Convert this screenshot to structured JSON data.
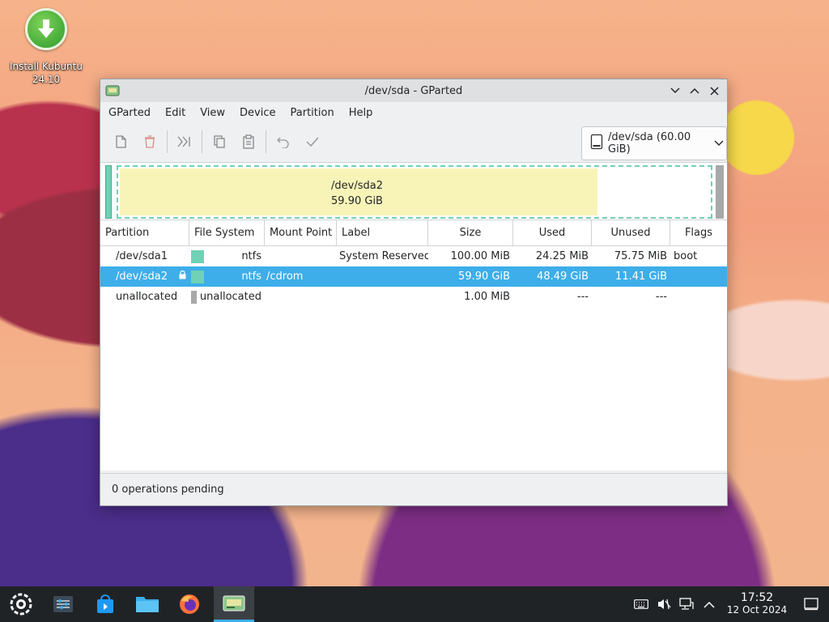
{
  "desktop": {
    "icon_label_line1": "Install Kubuntu",
    "icon_label_line2": "24.10"
  },
  "window": {
    "title": "/dev/sda - GParted"
  },
  "menubar": {
    "items": [
      "GParted",
      "Edit",
      "View",
      "Device",
      "Partition",
      "Help"
    ]
  },
  "toolbar": {
    "device_select": "/dev/sda (60.00 GiB)"
  },
  "partition_map": {
    "selected_name": "/dev/sda2",
    "selected_size": "59.90 GiB",
    "sda2_used_fraction": 0.81
  },
  "table": {
    "headers": [
      "Partition",
      "File System",
      "Mount Point",
      "Label",
      "Size",
      "Used",
      "Unused",
      "Flags"
    ],
    "rows": [
      {
        "partition": "/dev/sda1",
        "locked": false,
        "fs": "ntfs",
        "fs_color": "#6fd1b5",
        "mount": "",
        "label": "System Reserved",
        "size": "100.00 MiB",
        "used": "24.25 MiB",
        "unused": "75.75 MiB",
        "flags": "boot",
        "selected": false
      },
      {
        "partition": "/dev/sda2",
        "locked": true,
        "fs": "ntfs",
        "fs_color": "#6fd1b5",
        "mount": "/cdrom",
        "label": "",
        "size": "59.90 GiB",
        "used": "48.49 GiB",
        "unused": "11.41 GiB",
        "flags": "",
        "selected": true
      },
      {
        "partition": "unallocated",
        "locked": false,
        "fs": "unallocated",
        "fs_color": "#a8a8a8",
        "mount": "",
        "label": "",
        "size": "1.00 MiB",
        "used": "---",
        "unused": "---",
        "flags": "",
        "selected": false
      }
    ]
  },
  "statusbar": {
    "text": "0 operations pending"
  },
  "taskbar": {
    "time": "17:52",
    "date": "12 Oct 2024"
  },
  "colors": {
    "accent": "#3daee9",
    "ntfs": "#6fd1b5",
    "unallocated": "#a8a8a8",
    "used_fill": "#f8f4b8"
  }
}
